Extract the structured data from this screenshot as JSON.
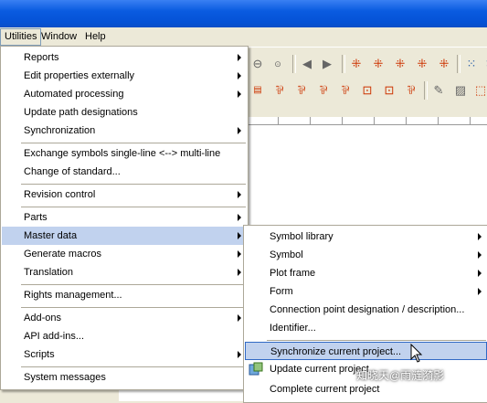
{
  "menubar": {
    "items": [
      {
        "label": "Utilities",
        "open": true
      },
      {
        "label": "Window"
      },
      {
        "label": "Help"
      }
    ]
  },
  "toolbar": {
    "row1": [
      "zoom-out-icon",
      "zoom-100-icon",
      "back-icon",
      "forward-icon",
      "symbol-grid-icon",
      "symbol-grid-icon",
      "symbol-grid-icon",
      "symbol-grid-icon",
      "symbol-grid-icon",
      "grid-icon",
      "grid-icon"
    ],
    "row2": [
      "wire-icon",
      "connection-icon",
      "connection-icon",
      "connection-icon",
      "connection-icon",
      "connection-icon",
      "connection-icon",
      "connection-icon",
      "edit-icon",
      "pattern-icon",
      "box-icon"
    ]
  },
  "menu_utilities": {
    "items": [
      {
        "label": "Reports",
        "submenu": true
      },
      {
        "label": "Edit properties externally",
        "submenu": true
      },
      {
        "label": "Automated processing",
        "submenu": true
      },
      {
        "label": "Update path designations",
        "submenu": false
      },
      {
        "label": "Synchronization",
        "submenu": true
      },
      {
        "label": "Exchange symbols single-line <--> multi-line",
        "submenu": false
      },
      {
        "label": "Change of standard...",
        "submenu": false
      },
      {
        "label": "Revision control",
        "submenu": true
      },
      {
        "label": "Parts",
        "submenu": true
      },
      {
        "label": "Master data",
        "submenu": true,
        "highlighted": true
      },
      {
        "label": "Generate macros",
        "submenu": true
      },
      {
        "label": "Translation",
        "submenu": true
      },
      {
        "label": "Rights management...",
        "submenu": false
      },
      {
        "label": "Add-ons",
        "submenu": true
      },
      {
        "label": "API add-ins...",
        "submenu": false
      },
      {
        "label": "Scripts",
        "submenu": true
      },
      {
        "label": "System messages",
        "submenu": false
      }
    ]
  },
  "menu_master_data": {
    "items": [
      {
        "label": "Symbol library",
        "submenu": true
      },
      {
        "label": "Symbol",
        "submenu": true
      },
      {
        "label": "Plot frame",
        "submenu": true
      },
      {
        "label": "Form",
        "submenu": true
      },
      {
        "label": "Connection point designation / description...",
        "submenu": false
      },
      {
        "label": "Identifier...",
        "submenu": false
      },
      {
        "label": "Synchronize current project...",
        "submenu": false,
        "highlighted": true
      },
      {
        "label": "Update current project",
        "submenu": false,
        "icon": "update-project-icon"
      },
      {
        "label": "Complete current project",
        "submenu": false
      }
    ]
  },
  "watermark": "知晓天@雨涟漪影",
  "colors": {
    "menu_highlight": "#c1d2ee",
    "menu_highlight_border": "#316ac5",
    "titlebar": "#0a5be0"
  }
}
